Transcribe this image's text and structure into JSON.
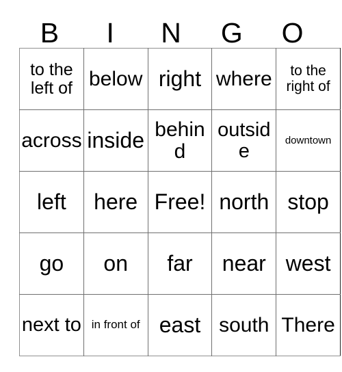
{
  "card": {
    "header_letters": [
      "B",
      "I",
      "N",
      "G",
      "O"
    ],
    "rows": [
      [
        {
          "text": "to the left of",
          "size": "fs-md"
        },
        {
          "text": "below",
          "size": "fs-xl"
        },
        {
          "text": "right",
          "size": "fs-xxl"
        },
        {
          "text": "where",
          "size": "fs-xl"
        },
        {
          "text": "to the right of",
          "size": "fs-sm"
        }
      ],
      [
        {
          "text": "across",
          "size": "fs-xl"
        },
        {
          "text": "inside",
          "size": "fs-xxl"
        },
        {
          "text": "behind",
          "size": "fs-xl"
        },
        {
          "text": "outside",
          "size": "fs-lg"
        },
        {
          "text": "downtown",
          "size": "fs-xxs"
        }
      ],
      [
        {
          "text": "left",
          "size": "fs-xxl"
        },
        {
          "text": "here",
          "size": "fs-xxl"
        },
        {
          "text": "Free!",
          "size": "fs-xxl"
        },
        {
          "text": "north",
          "size": "fs-xxl"
        },
        {
          "text": "stop",
          "size": "fs-xxl"
        }
      ],
      [
        {
          "text": "go",
          "size": "fs-xxl"
        },
        {
          "text": "on",
          "size": "fs-xxl"
        },
        {
          "text": "far",
          "size": "fs-xxl"
        },
        {
          "text": "near",
          "size": "fs-xxl"
        },
        {
          "text": "west",
          "size": "fs-xxl"
        }
      ],
      [
        {
          "text": "next to",
          "size": "fs-lg"
        },
        {
          "text": "in front of",
          "size": "fs-xs"
        },
        {
          "text": "east",
          "size": "fs-xxl"
        },
        {
          "text": "south",
          "size": "fs-xl"
        },
        {
          "text": "There",
          "size": "fs-xl"
        }
      ]
    ],
    "free_space": "Free!",
    "colors": {
      "background": "#ffffff",
      "text": "#000000",
      "grid_line": "#6f6f6f",
      "outer_border": "#909090"
    }
  }
}
